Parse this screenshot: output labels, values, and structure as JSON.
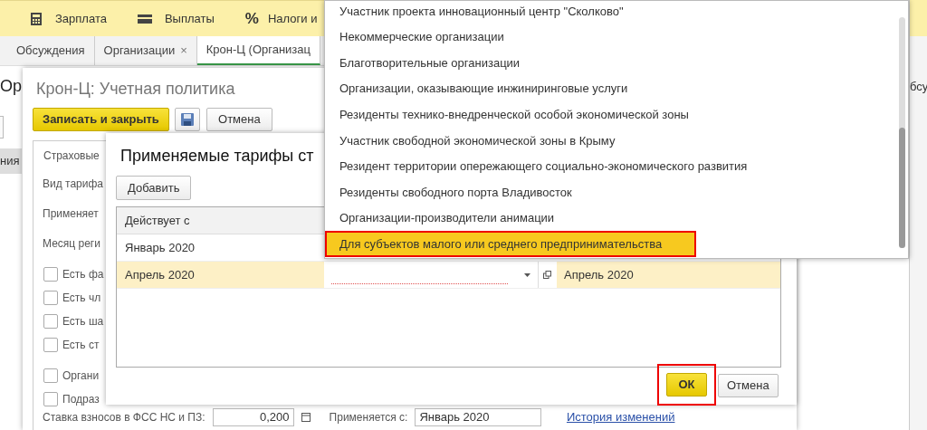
{
  "top_menu": [
    {
      "kind": "calculator",
      "label": "Зарплата"
    },
    {
      "kind": "wallet",
      "label": "Выплаты"
    },
    {
      "kind": "glyph",
      "glyph": "%",
      "label": "Налоги и"
    }
  ],
  "tabs": [
    {
      "label": "Обсуждения",
      "selected": false
    },
    {
      "label": "Организации",
      "selected": false,
      "close": "×"
    },
    {
      "label": "Крон-Ц (Организац",
      "selected": true
    }
  ],
  "background": {
    "heading": "Ор",
    "sidebar_item": "ния",
    "right_text": "бсу"
  },
  "form": {
    "title": "Крон-Ц: Учетная политика",
    "save_close": "Записать и закрыть",
    "cancel": "Отмена",
    "tab": "Страховые",
    "fields": [
      "Вид тарифа",
      "Применяет",
      "Месяц реги"
    ],
    "checkboxes": [
      {
        "label": "Есть фа",
        "checked": false
      },
      {
        "label": "Есть чл",
        "checked": false
      },
      {
        "label": "Есть ша",
        "checked": false
      },
      {
        "label": "Есть ст",
        "checked": false
      },
      {
        "label": "Органи",
        "checked": false
      },
      {
        "label": "Подраз",
        "checked": false
      }
    ],
    "bottom": {
      "rate_label": "Ставка взносов в ФСС НС и ПЗ:",
      "rate": "0,200",
      "applies_label": "Применяется с:",
      "applies": "Январь 2020",
      "history_link": "История изменений"
    }
  },
  "dialog": {
    "title": "Применяемые тарифы ст",
    "add": "Добавить",
    "table": {
      "columns": [
        "Действует с"
      ],
      "rows": [
        {
          "date": "Январь 2020",
          "selected": false,
          "editing": false
        },
        {
          "date": "Апрель 2020",
          "selected": true,
          "editing": true,
          "column_3": "Апрель 2020"
        }
      ]
    },
    "ok": "ОК",
    "ok_highlighted": true,
    "cancel": "Отмена"
  },
  "dropdown": {
    "items": [
      {
        "label": "Участник проекта инновационный центр \"Сколково\"",
        "selected": false,
        "highlighted": false
      },
      {
        "label": "Некоммерческие организации",
        "selected": false,
        "highlighted": false
      },
      {
        "label": "Благотворительные организации",
        "selected": false,
        "highlighted": false
      },
      {
        "label": "Организации, оказывающие инжиниринговые услуги",
        "selected": false,
        "highlighted": false
      },
      {
        "label": "Резиденты технико-внедренческой особой экономической зоны",
        "selected": false,
        "highlighted": false
      },
      {
        "label": "Участник свободной экономической зоны в Крыму",
        "selected": false,
        "highlighted": false
      },
      {
        "label": "Резидент территории опережающего социально-экономического развития",
        "selected": false,
        "highlighted": false
      },
      {
        "label": "Резиденты свободного порта Владивосток",
        "selected": false,
        "highlighted": false
      },
      {
        "label": "Организации-производители анимации",
        "selected": false,
        "highlighted": false
      },
      {
        "label": "Для субъектов малого или среднего предпринимательства",
        "selected": true,
        "highlighted": true
      }
    ]
  }
}
